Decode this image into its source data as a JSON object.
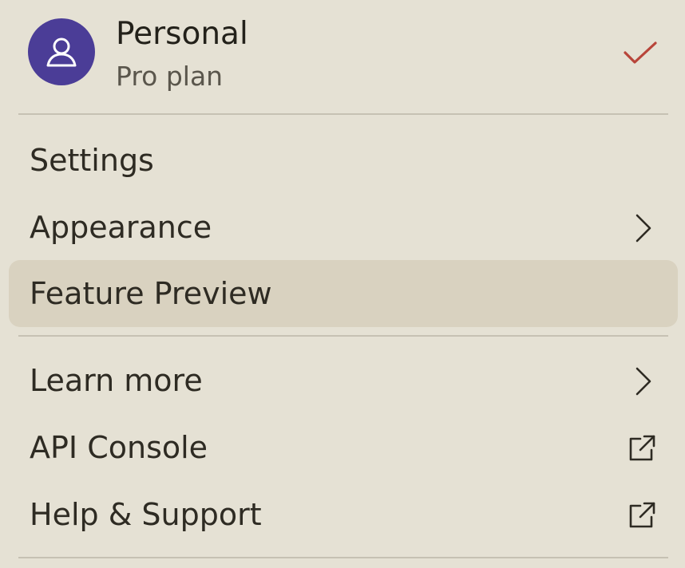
{
  "account": {
    "name": "Personal",
    "plan": "Pro plan",
    "avatar_icon": "user-icon",
    "selected_icon": "checkmark-icon",
    "avatar_color": "#4b3d97",
    "check_color": "#b8453a"
  },
  "menu": {
    "groups": [
      {
        "items": [
          {
            "label": "Settings",
            "icon": ""
          },
          {
            "label": "Appearance",
            "icon": "chevron-right-icon"
          },
          {
            "label": "Feature Preview",
            "icon": "",
            "highlighted": true
          }
        ]
      },
      {
        "items": [
          {
            "label": "Learn more",
            "icon": "chevron-right-icon"
          },
          {
            "label": "API Console",
            "icon": "external-link-icon"
          },
          {
            "label": "Help & Support",
            "icon": "external-link-icon"
          }
        ]
      }
    ]
  },
  "colors": {
    "background": "#e5e1d4",
    "highlight": "#d9d2c0",
    "divider": "#c6c1b3",
    "text": "#2e2b23"
  }
}
